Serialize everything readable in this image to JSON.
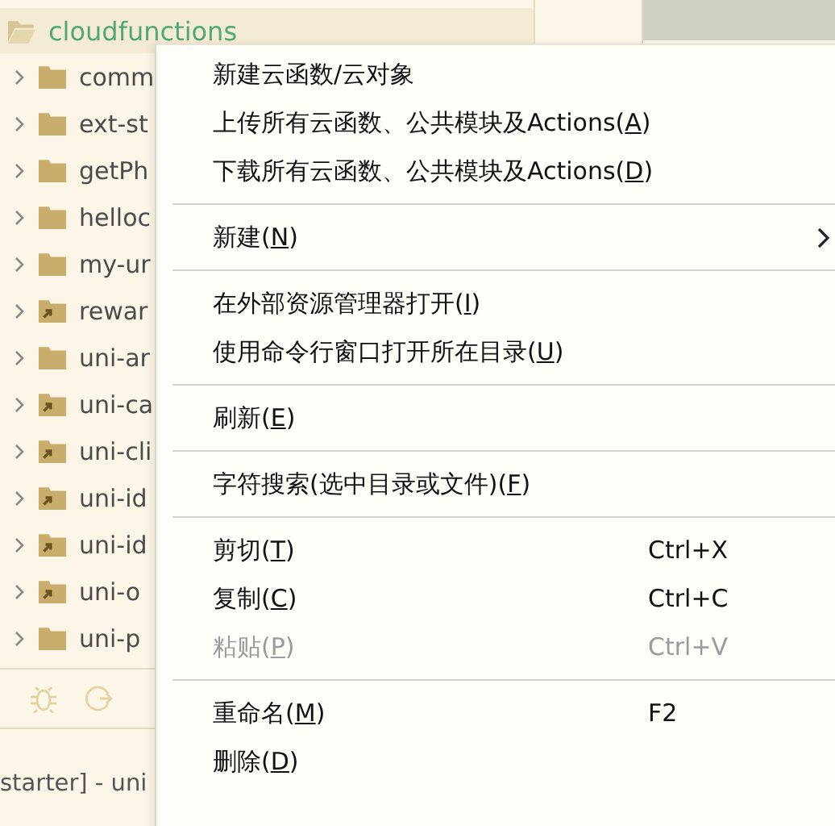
{
  "project_tree": {
    "root": {
      "label": "cloudfunctions"
    },
    "items": [
      {
        "label": "comm",
        "kind": "folder"
      },
      {
        "label": "ext-st",
        "kind": "folder"
      },
      {
        "label": "getPh",
        "kind": "folder"
      },
      {
        "label": "helloc",
        "kind": "folder"
      },
      {
        "label": "my-ur",
        "kind": "folder"
      },
      {
        "label": "rewar",
        "kind": "linked_folder"
      },
      {
        "label": "uni-ar",
        "kind": "folder"
      },
      {
        "label": "uni-ca",
        "kind": "linked_folder"
      },
      {
        "label": "uni-cli",
        "kind": "linked_folder"
      },
      {
        "label": "uni-id",
        "kind": "linked_folder"
      },
      {
        "label": "uni-id",
        "kind": "linked_folder"
      },
      {
        "label": "uni-o",
        "kind": "linked_folder"
      },
      {
        "label": "uni-p",
        "kind": "folder"
      }
    ]
  },
  "status_text": "starter] - uni",
  "context_menu": [
    [
      {
        "before": "新建云函数/云对象",
        "disabled": false,
        "submenu": false
      },
      {
        "before": "上传所有云函数、公共模块及Actions(",
        "key": "A",
        "after": ")",
        "disabled": false,
        "submenu": false
      },
      {
        "before": "下载所有云函数、公共模块及Actions(",
        "key": "D",
        "after": ")",
        "disabled": false,
        "submenu": false
      }
    ],
    [
      {
        "before": "新建(",
        "key": "N",
        "after": ")",
        "disabled": false,
        "submenu": true
      }
    ],
    [
      {
        "before": "在外部资源管理器打开(",
        "key": "I",
        "after": ")",
        "disabled": false,
        "submenu": false
      },
      {
        "before": "使用命令行窗口打开所在目录(",
        "key": "U",
        "after": ")",
        "disabled": false,
        "submenu": false
      }
    ],
    [
      {
        "before": "刷新(",
        "key": "E",
        "after": ")",
        "disabled": false,
        "submenu": false
      }
    ],
    [
      {
        "before": "字符搜索(选中目录或文件)(",
        "key": "F",
        "after": ")",
        "disabled": false,
        "submenu": false
      }
    ],
    [
      {
        "before": "剪切(",
        "key": "T",
        "after": ")",
        "shortcut": "Ctrl+X",
        "disabled": false,
        "submenu": false
      },
      {
        "before": "复制(",
        "key": "C",
        "after": ")",
        "shortcut": "Ctrl+C",
        "disabled": false,
        "submenu": false
      },
      {
        "before": "粘贴(",
        "key": "P",
        "after": ")",
        "shortcut": "Ctrl+V",
        "disabled": true,
        "submenu": false
      }
    ],
    [
      {
        "before": "重命名(",
        "key": "M",
        "after": ")",
        "shortcut": "F2",
        "disabled": false,
        "submenu": false
      },
      {
        "before": "删除(",
        "key": "D",
        "after": ")",
        "disabled": false,
        "submenu": false
      }
    ]
  ]
}
